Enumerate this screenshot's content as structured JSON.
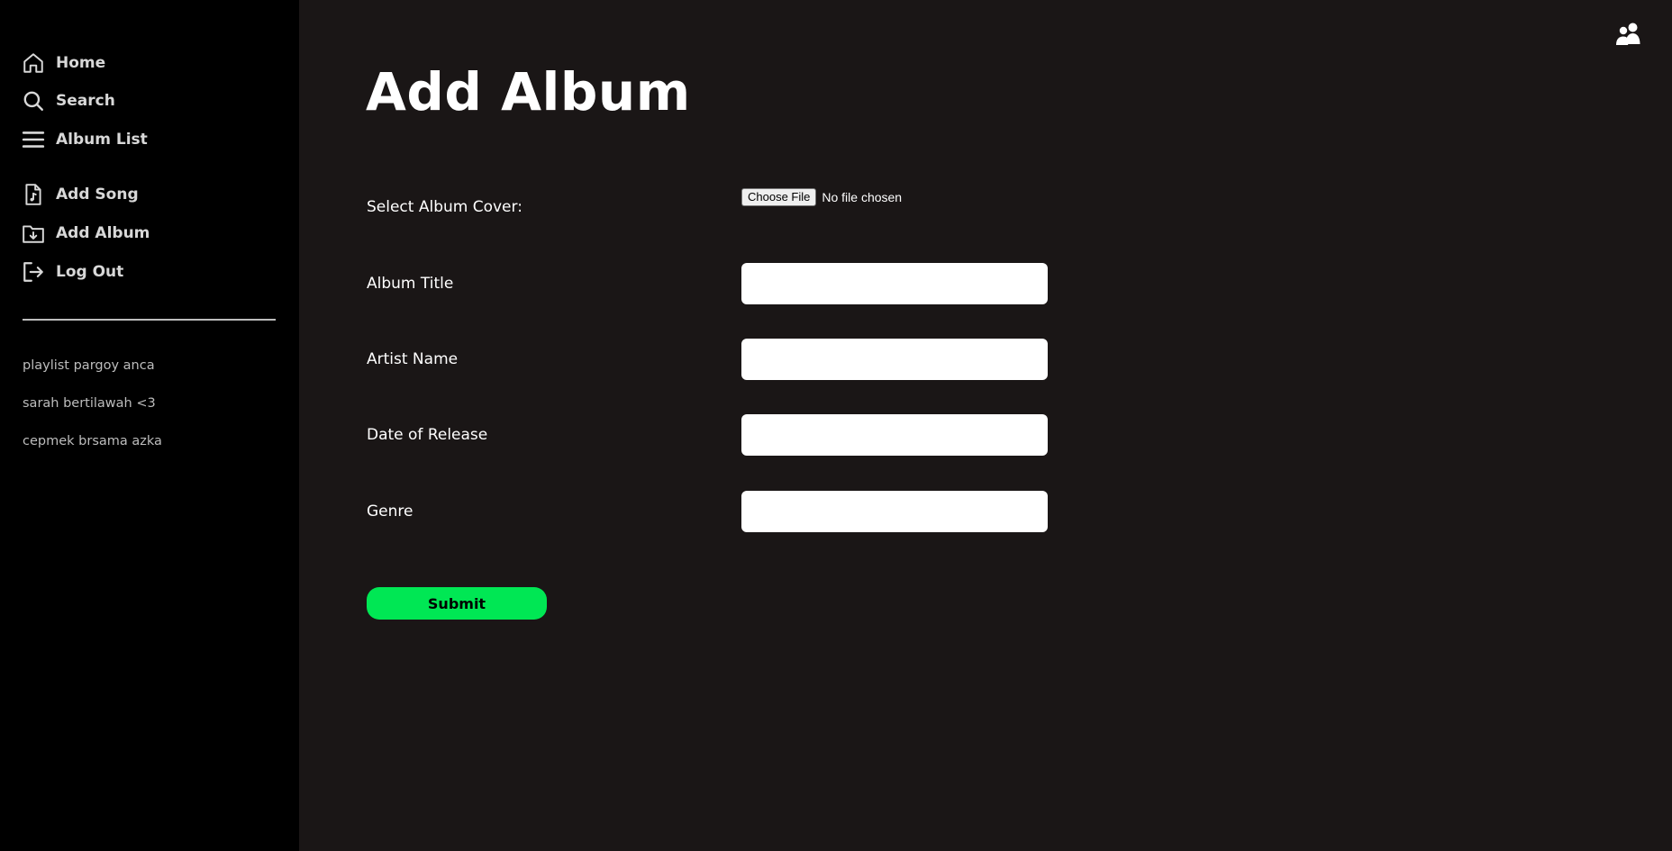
{
  "sidebar": {
    "nav": [
      {
        "label": "Home",
        "icon": "home-icon"
      },
      {
        "label": "Search",
        "icon": "search-icon"
      },
      {
        "label": "Album List",
        "icon": "list-icon"
      },
      {
        "label": "Add Song",
        "icon": "music-file-icon"
      },
      {
        "label": "Add Album",
        "icon": "folder-download-icon"
      },
      {
        "label": "Log Out",
        "icon": "logout-icon"
      }
    ],
    "playlists": [
      "playlist pargoy anca",
      "sarah bertilawah <3",
      "cepmek brsama azka"
    ]
  },
  "header": {
    "user_icon": "users-icon"
  },
  "main": {
    "title": "Add Album",
    "form": {
      "cover_label": "Select Album Cover:",
      "file_button_label": "Choose File",
      "file_status": "No file chosen",
      "album_title_label": "Album Title",
      "album_title_value": "",
      "artist_name_label": "Artist Name",
      "artist_name_value": "",
      "release_date_label": "Date of Release",
      "release_date_value": "",
      "genre_label": "Genre",
      "genre_value": "",
      "submit_label": "Submit"
    }
  },
  "colors": {
    "sidebar_bg": "#000000",
    "main_bg": "#1a1616",
    "accent": "#00e754",
    "nav_text": "#d8d8d8"
  }
}
